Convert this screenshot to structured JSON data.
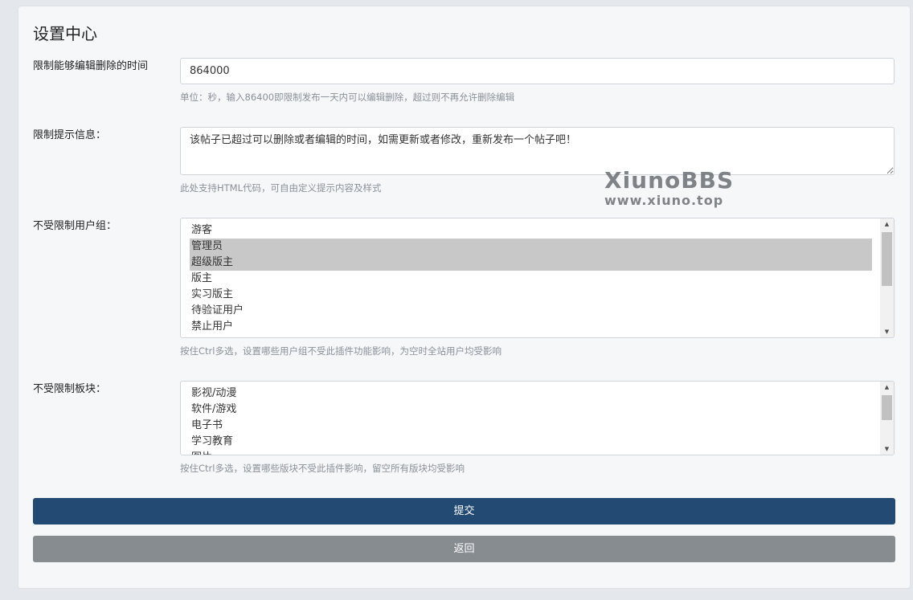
{
  "page": {
    "title": "设置中心"
  },
  "fields": {
    "time_limit": {
      "label": "限制能够编辑删除的时间",
      "value": "864000",
      "help": "单位：秒，输入86400即限制发布一天内可以编辑删除，超过则不再允许删除编辑"
    },
    "tip_message": {
      "label": "限制提示信息：",
      "value": "该帖子已超过可以删除或者编辑的时间，如需更新或者修改，重新发布一个帖子吧！",
      "help": "此处支持HTML代码，可自由定义提示内容及样式"
    },
    "user_groups": {
      "label": "不受限制用户组：",
      "options": [
        "游客",
        "管理员",
        "超级版主",
        "版主",
        "实习版主",
        "待验证用户",
        "禁止用户"
      ],
      "selected": [
        "管理员",
        "超级版主"
      ],
      "help": "按住Ctrl多选，设置哪些用户组不受此插件功能影响，为空时全站用户均受影响"
    },
    "forums": {
      "label": "不受限制板块：",
      "options": [
        "影视/动漫",
        "软件/游戏",
        "电子书",
        "学习教育",
        "图片"
      ],
      "help": "按住Ctrl多选，设置哪些版块不受此插件影响，留空所有版块均受影响"
    }
  },
  "buttons": {
    "submit": "提交",
    "back": "返回"
  },
  "watermark": {
    "line1": "XiunoBBS",
    "line2": "www.xiuno.top"
  },
  "colors": {
    "primary": "#224a73",
    "secondary": "#878c91",
    "selected_option": "#c8c8c8"
  }
}
